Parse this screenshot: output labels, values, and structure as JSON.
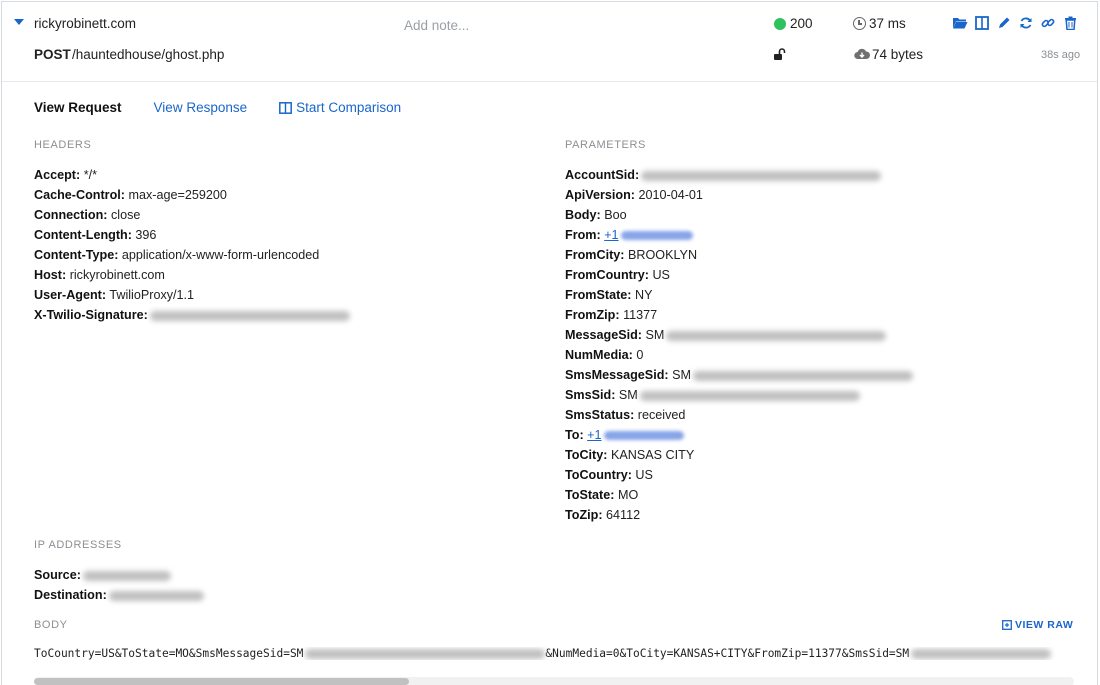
{
  "summary": {
    "host": "rickyrobinett.com",
    "note_placeholder": "Add note...",
    "status_code": "200",
    "status_color": "#2fc15e",
    "response_time": "37 ms",
    "method": "POST",
    "path": "/hauntedhouse/ghost.php",
    "size": "74 bytes",
    "age": "38s ago",
    "toolbar_icons": [
      "folder-open-icon",
      "split-view-icon",
      "edit-pencil-icon",
      "refresh-icon",
      "link-icon",
      "trash-icon"
    ]
  },
  "tabs": {
    "view_request": "View Request",
    "view_response": "View Response",
    "start_comparison": "Start Comparison"
  },
  "headers_section": {
    "label": "HEADERS",
    "items": [
      {
        "key": "Accept:",
        "value": "*/*"
      },
      {
        "key": "Cache-Control:",
        "value": "max-age=259200"
      },
      {
        "key": "Connection:",
        "value": "close"
      },
      {
        "key": "Content-Length:",
        "value": "396"
      },
      {
        "key": "Content-Type:",
        "value": "application/x-www-form-urlencoded"
      },
      {
        "key": "Host:",
        "value": "rickyrobinett.com"
      },
      {
        "key": "User-Agent:",
        "value": "TwilioProxy/1.1"
      },
      {
        "key": "X-Twilio-Signature:",
        "value": ""
      }
    ]
  },
  "parameters_section": {
    "label": "PARAMETERS",
    "items": [
      {
        "key": "AccountSid:",
        "value": ""
      },
      {
        "key": "ApiVersion:",
        "value": "2010-04-01"
      },
      {
        "key": "Body:",
        "value": "Boo"
      },
      {
        "key": "From:",
        "value": "+1"
      },
      {
        "key": "FromCity:",
        "value": "BROOKLYN"
      },
      {
        "key": "FromCountry:",
        "value": "US"
      },
      {
        "key": "FromState:",
        "value": "NY"
      },
      {
        "key": "FromZip:",
        "value": "11377"
      },
      {
        "key": "MessageSid:",
        "value": "SM"
      },
      {
        "key": "NumMedia:",
        "value": "0"
      },
      {
        "key": "SmsMessageSid:",
        "value": "SM"
      },
      {
        "key": "SmsSid:",
        "value": "SM"
      },
      {
        "key": "SmsStatus:",
        "value": "received"
      },
      {
        "key": "To:",
        "value": "+1"
      },
      {
        "key": "ToCity:",
        "value": "KANSAS CITY"
      },
      {
        "key": "ToCountry:",
        "value": "US"
      },
      {
        "key": "ToState:",
        "value": "MO"
      },
      {
        "key": "ToZip:",
        "value": "64112"
      }
    ]
  },
  "ip_section": {
    "label": "IP ADDRESSES",
    "source_label": "Source:",
    "destination_label": "Destination:"
  },
  "body_section": {
    "label": "BODY",
    "view_raw": "VIEW RAW",
    "part1": "ToCountry=US&ToState=MO&SmsMessageSid=SM",
    "part2": "&NumMedia=0&ToCity=KANSAS+CITY&FromZip=11377&SmsSid=SM"
  }
}
